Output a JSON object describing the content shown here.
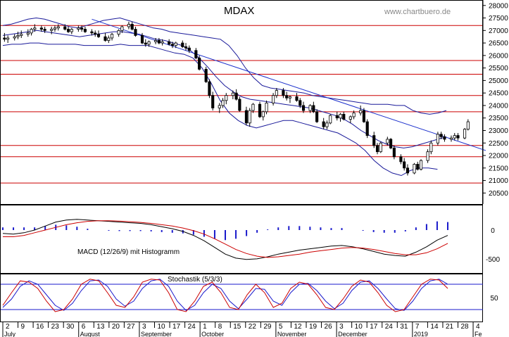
{
  "chart_data": {
    "type": "candlestick",
    "title": "MDAX",
    "watermark": "www.chartbuero.de",
    "price_axis": {
      "ticks": [
        "28000",
        "27500",
        "27000",
        "26500",
        "26000",
        "25500",
        "25000",
        "24500",
        "24000",
        "23500",
        "23000",
        "22500",
        "22000",
        "21500",
        "21000",
        "20500"
      ],
      "ylim": [
        20200,
        28050
      ]
    },
    "horizontal_lines": [
      27200,
      25800,
      25250,
      24400,
      23750,
      22400,
      21950,
      20900
    ],
    "trendline": {
      "from": {
        "t": 26,
        "y": 27450
      },
      "to": {
        "t": 132,
        "y": 22200
      }
    },
    "x_axis": {
      "day_ticks": [
        "2",
        "9",
        "16",
        "23",
        "30",
        "6",
        "13",
        "20",
        "27",
        "3",
        "10",
        "17",
        "24",
        "1",
        "8",
        "15",
        "22",
        "29",
        "5",
        "12",
        "19",
        "26",
        "3",
        "10",
        "17",
        "24",
        "31",
        "7",
        "14",
        "21",
        "28",
        "4"
      ],
      "months": [
        "July",
        "August",
        "September",
        "October",
        "November",
        "December",
        "2019",
        "Fe"
      ]
    },
    "ohlc": [
      [
        26700,
        26900,
        26550,
        26650
      ],
      [
        26650,
        26800,
        26500,
        26700
      ],
      [
        26700,
        26850,
        26600,
        26750
      ],
      [
        26750,
        26950,
        26650,
        26800
      ],
      [
        26800,
        27000,
        26700,
        26850
      ],
      [
        26850,
        27050,
        26750,
        26900
      ],
      [
        26900,
        27100,
        26800,
        27050
      ],
      [
        27050,
        27250,
        26950,
        27100
      ],
      [
        27100,
        27200,
        26950,
        27050
      ],
      [
        27050,
        27150,
        26900,
        27000
      ],
      [
        27000,
        27150,
        26850,
        27050
      ],
      [
        27050,
        27200,
        26950,
        27100
      ],
      [
        27100,
        27250,
        27000,
        27150
      ],
      [
        27150,
        27250,
        27000,
        27050
      ],
      [
        27050,
        27150,
        26900,
        26950
      ],
      [
        26950,
        27100,
        26850,
        27050
      ],
      [
        27050,
        27200,
        26950,
        27100
      ],
      [
        27100,
        27200,
        26950,
        27050
      ],
      [
        27050,
        27150,
        26900,
        26950
      ],
      [
        26950,
        27050,
        26800,
        26900
      ],
      [
        26900,
        27000,
        26750,
        26850
      ],
      [
        26850,
        27000,
        26700,
        26750
      ],
      [
        26750,
        26900,
        26550,
        26600
      ],
      [
        26600,
        26800,
        26500,
        26700
      ],
      [
        26700,
        26900,
        26600,
        26850
      ],
      [
        26850,
        27050,
        26750,
        27000
      ],
      [
        27000,
        27200,
        26900,
        27150
      ],
      [
        27150,
        27350,
        27050,
        27250
      ],
      [
        27250,
        27350,
        27000,
        27050
      ],
      [
        27050,
        27150,
        26750,
        26800
      ],
      [
        26800,
        26900,
        26450,
        26500
      ],
      [
        26500,
        26650,
        26350,
        26450
      ],
      [
        26450,
        26600,
        26350,
        26550
      ],
      [
        26550,
        26700,
        26450,
        26600
      ],
      [
        26600,
        26700,
        26450,
        26500
      ],
      [
        26500,
        26650,
        26400,
        26550
      ],
      [
        26550,
        26650,
        26400,
        26450
      ],
      [
        26450,
        26550,
        26300,
        26400
      ],
      [
        26400,
        26550,
        26300,
        26500
      ],
      [
        26500,
        26600,
        26300,
        26350
      ],
      [
        26350,
        26500,
        26200,
        26300
      ],
      [
        26300,
        26400,
        26100,
        26200
      ],
      [
        26200,
        26300,
        25850,
        25900
      ],
      [
        25900,
        26000,
        25400,
        25450
      ],
      [
        25450,
        25550,
        24900,
        24950
      ],
      [
        24950,
        25050,
        24300,
        24400
      ],
      [
        24400,
        24550,
        23800,
        23900
      ],
      [
        23900,
        24100,
        23700,
        24000
      ],
      [
        24000,
        24300,
        23900,
        24200
      ],
      [
        24200,
        24500,
        24050,
        24400
      ],
      [
        24400,
        24600,
        24250,
        24500
      ],
      [
        24500,
        24650,
        24200,
        24250
      ],
      [
        24250,
        24350,
        23750,
        23800
      ],
      [
        23800,
        23950,
        23200,
        23300
      ],
      [
        23300,
        23900,
        23150,
        23800
      ],
      [
        23800,
        24100,
        23700,
        24050
      ],
      [
        24050,
        24150,
        23500,
        23550
      ],
      [
        23550,
        23800,
        23400,
        23750
      ],
      [
        23750,
        24200,
        23650,
        24100
      ],
      [
        24100,
        24500,
        24000,
        24400
      ],
      [
        24400,
        24700,
        24300,
        24600
      ],
      [
        24600,
        24700,
        24300,
        24400
      ],
      [
        24400,
        24550,
        24200,
        24300
      ],
      [
        24300,
        24400,
        24100,
        24350
      ],
      [
        24350,
        24500,
        24150,
        24200
      ],
      [
        24200,
        24300,
        23900,
        24000
      ],
      [
        24000,
        24150,
        23700,
        23800
      ],
      [
        23800,
        24050,
        23700,
        24000
      ],
      [
        24000,
        24150,
        23700,
        23750
      ],
      [
        23750,
        23850,
        23300,
        23350
      ],
      [
        23350,
        23500,
        23050,
        23150
      ],
      [
        23150,
        23400,
        23050,
        23300
      ],
      [
        23300,
        23650,
        23250,
        23600
      ],
      [
        23600,
        23750,
        23400,
        23500
      ],
      [
        23500,
        23700,
        23350,
        23650
      ],
      [
        23650,
        23750,
        23400,
        23450
      ],
      [
        23450,
        23600,
        23300,
        23550
      ],
      [
        23550,
        23800,
        23450,
        23700
      ],
      [
        23700,
        24000,
        23600,
        23800
      ],
      [
        23800,
        23900,
        23300,
        23350
      ],
      [
        23350,
        23450,
        22700,
        22800
      ],
      [
        22800,
        22950,
        22300,
        22400
      ],
      [
        22400,
        22500,
        22050,
        22150
      ],
      [
        22150,
        22550,
        22100,
        22500
      ],
      [
        22500,
        22750,
        22400,
        22650
      ],
      [
        22650,
        22700,
        22250,
        22300
      ],
      [
        22300,
        22400,
        21850,
        21950
      ],
      [
        21950,
        22050,
        21650,
        21750
      ],
      [
        21750,
        21900,
        21400,
        21500
      ],
      [
        21500,
        21650,
        21200,
        21300
      ],
      [
        21300,
        21700,
        21250,
        21650
      ],
      [
        21650,
        21750,
        21400,
        21450
      ],
      [
        21450,
        21850,
        21400,
        21800
      ],
      [
        21800,
        22250,
        21700,
        22150
      ],
      [
        22150,
        22600,
        22050,
        22500
      ],
      [
        22500,
        22950,
        22400,
        22850
      ],
      [
        22850,
        22950,
        22650,
        22750
      ],
      [
        22750,
        22850,
        22550,
        22650
      ],
      [
        22650,
        22800,
        22550,
        22700
      ],
      [
        22700,
        22900,
        22600,
        22800
      ],
      [
        22800,
        22900,
        22600,
        22700
      ],
      [
        22700,
        23100,
        22650,
        23050
      ],
      [
        23050,
        23450,
        23000,
        23350
      ]
    ],
    "bollinger": {
      "upper": [
        27200,
        27250,
        27350,
        27450,
        27500,
        27450,
        27350,
        27250,
        27150,
        27100,
        27200,
        27300,
        27400,
        27450,
        27500,
        27400,
        27300,
        27200,
        27100,
        27050,
        26950,
        26900,
        26850,
        26800,
        26750,
        26700,
        26650,
        26400,
        26000,
        25500,
        25100,
        24800,
        24700,
        24650,
        24600,
        24550,
        24500,
        24400,
        24350,
        24300,
        24250,
        24200,
        24150,
        24100,
        24050,
        24050,
        24050,
        24000,
        24000,
        23800,
        23700,
        23650,
        23700,
        23800
      ],
      "middle": [
        26800,
        26850,
        26900,
        26950,
        27000,
        26950,
        26900,
        26850,
        26800,
        26750,
        26800,
        26850,
        26900,
        26950,
        26950,
        26900,
        26850,
        26750,
        26650,
        26600,
        26500,
        26400,
        26200,
        25900,
        25550,
        25150,
        24800,
        24550,
        24350,
        24250,
        24200,
        24150,
        24100,
        24050,
        24000,
        23950,
        23900,
        23800,
        23700,
        23600,
        23450,
        23250,
        23000,
        22800,
        22600,
        22450,
        22350,
        22300,
        22350,
        22450,
        22550,
        22650,
        22750
      ],
      "lower": [
        26400,
        26450,
        26450,
        26500,
        26500,
        26450,
        26450,
        26450,
        26450,
        26400,
        26400,
        26400,
        26400,
        26450,
        26400,
        26400,
        26400,
        26300,
        26200,
        26100,
        26050,
        25900,
        25500,
        24900,
        24200,
        23700,
        23400,
        23200,
        23100,
        23200,
        23300,
        23400,
        23400,
        23300,
        23200,
        23100,
        23000,
        22900,
        22700,
        22500,
        22200,
        21800,
        21500,
        21300,
        21200,
        21400,
        21500,
        21500,
        21450
      ]
    },
    "macd": {
      "label": "MACD (12/26/9) mit Histogramm",
      "zero_label": "0",
      "neg_label": "-500",
      "macd_line": [
        -50,
        -60,
        -40,
        0,
        60,
        120,
        150,
        160,
        150,
        140,
        130,
        120,
        110,
        100,
        80,
        50,
        20,
        -20,
        -80,
        -160,
        -260,
        -360,
        -420,
        -440,
        -430,
        -400,
        -360,
        -330,
        -300,
        -280,
        -260,
        -240,
        -230,
        -250,
        -280,
        -320,
        -360,
        -380,
        -390,
        -330,
        -250,
        -150,
        -80
      ],
      "signal_line": [
        -100,
        -100,
        -80,
        -40,
        0,
        40,
        80,
        110,
        130,
        140,
        140,
        135,
        125,
        115,
        100,
        80,
        60,
        30,
        -10,
        -60,
        -130,
        -210,
        -290,
        -350,
        -390,
        -410,
        -400,
        -380,
        -360,
        -330,
        -310,
        -290,
        -270,
        -260,
        -270,
        -290,
        -320,
        -350,
        -370,
        -370,
        -340,
        -280,
        -200
      ],
      "histogram": [
        40,
        40,
        40,
        40,
        60,
        80,
        70,
        50,
        20,
        0,
        -10,
        -15,
        -15,
        -15,
        -20,
        -30,
        -40,
        -50,
        -70,
        -100,
        -130,
        -150,
        -130,
        -90,
        -40,
        10,
        40,
        60,
        60,
        50,
        40,
        30,
        30,
        0,
        -10,
        -30,
        -40,
        -40,
        -20,
        40,
        90,
        130,
        120
      ]
    },
    "stochastic": {
      "label": "Stochastik (5/3/3)",
      "level_label": "50",
      "k_line": [
        30,
        60,
        88,
        85,
        70,
        40,
        15,
        20,
        45,
        80,
        92,
        88,
        60,
        30,
        25,
        50,
        85,
        92,
        90,
        60,
        20,
        15,
        40,
        75,
        85,
        60,
        25,
        20,
        55,
        80,
        60,
        25,
        35,
        70,
        85,
        80,
        55,
        25,
        20,
        45,
        75,
        90,
        85,
        60,
        30,
        15,
        20,
        50,
        80,
        92,
        90,
        70
      ],
      "d_line": [
        25,
        45,
        75,
        88,
        80,
        55,
        30,
        18,
        35,
        65,
        88,
        90,
        75,
        45,
        28,
        40,
        70,
        88,
        92,
        75,
        40,
        18,
        30,
        60,
        80,
        70,
        40,
        22,
        45,
        70,
        68,
        40,
        30,
        60,
        80,
        82,
        65,
        40,
        22,
        35,
        65,
        85,
        88,
        70,
        45,
        22,
        18,
        40,
        70,
        88,
        92,
        80
      ],
      "levels": [
        80,
        20
      ]
    }
  }
}
